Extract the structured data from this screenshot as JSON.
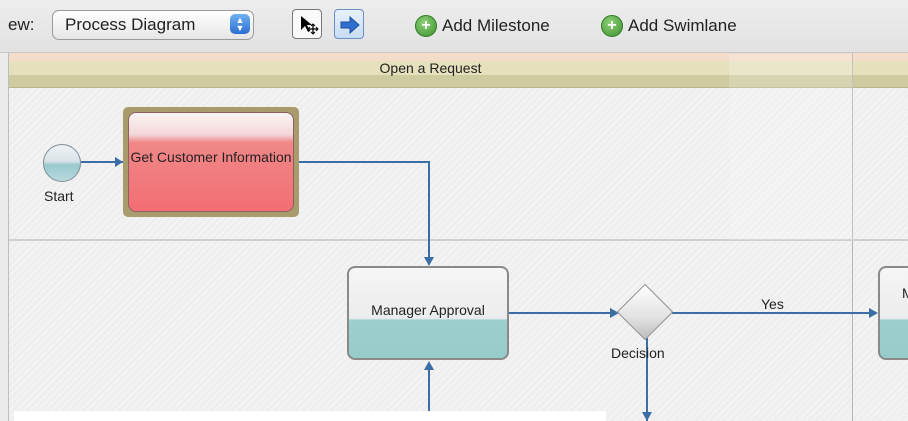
{
  "toolbar": {
    "view_label": "ew:",
    "view_select_value": "Process Diagram",
    "add_milestone": "Add Milestone",
    "add_swimlane": "Add Swimlane"
  },
  "diagram": {
    "milestone_title": "Open a Request",
    "start_label": "Start",
    "task_get_customer": "Get Customer Information",
    "task_manager_approval": "Manager Approval",
    "decision_label": "Decision",
    "yes_label": "Yes",
    "cut_task_label": "M"
  },
  "colors": {
    "connector": "#3b6ea5",
    "task_red": "#f26e74",
    "task_teal": "#98cbc9",
    "accent_blue": "#2c6fd1"
  },
  "icons": [
    "select-pointer-icon",
    "connector-arrow-icon",
    "add-plus-icon"
  ]
}
